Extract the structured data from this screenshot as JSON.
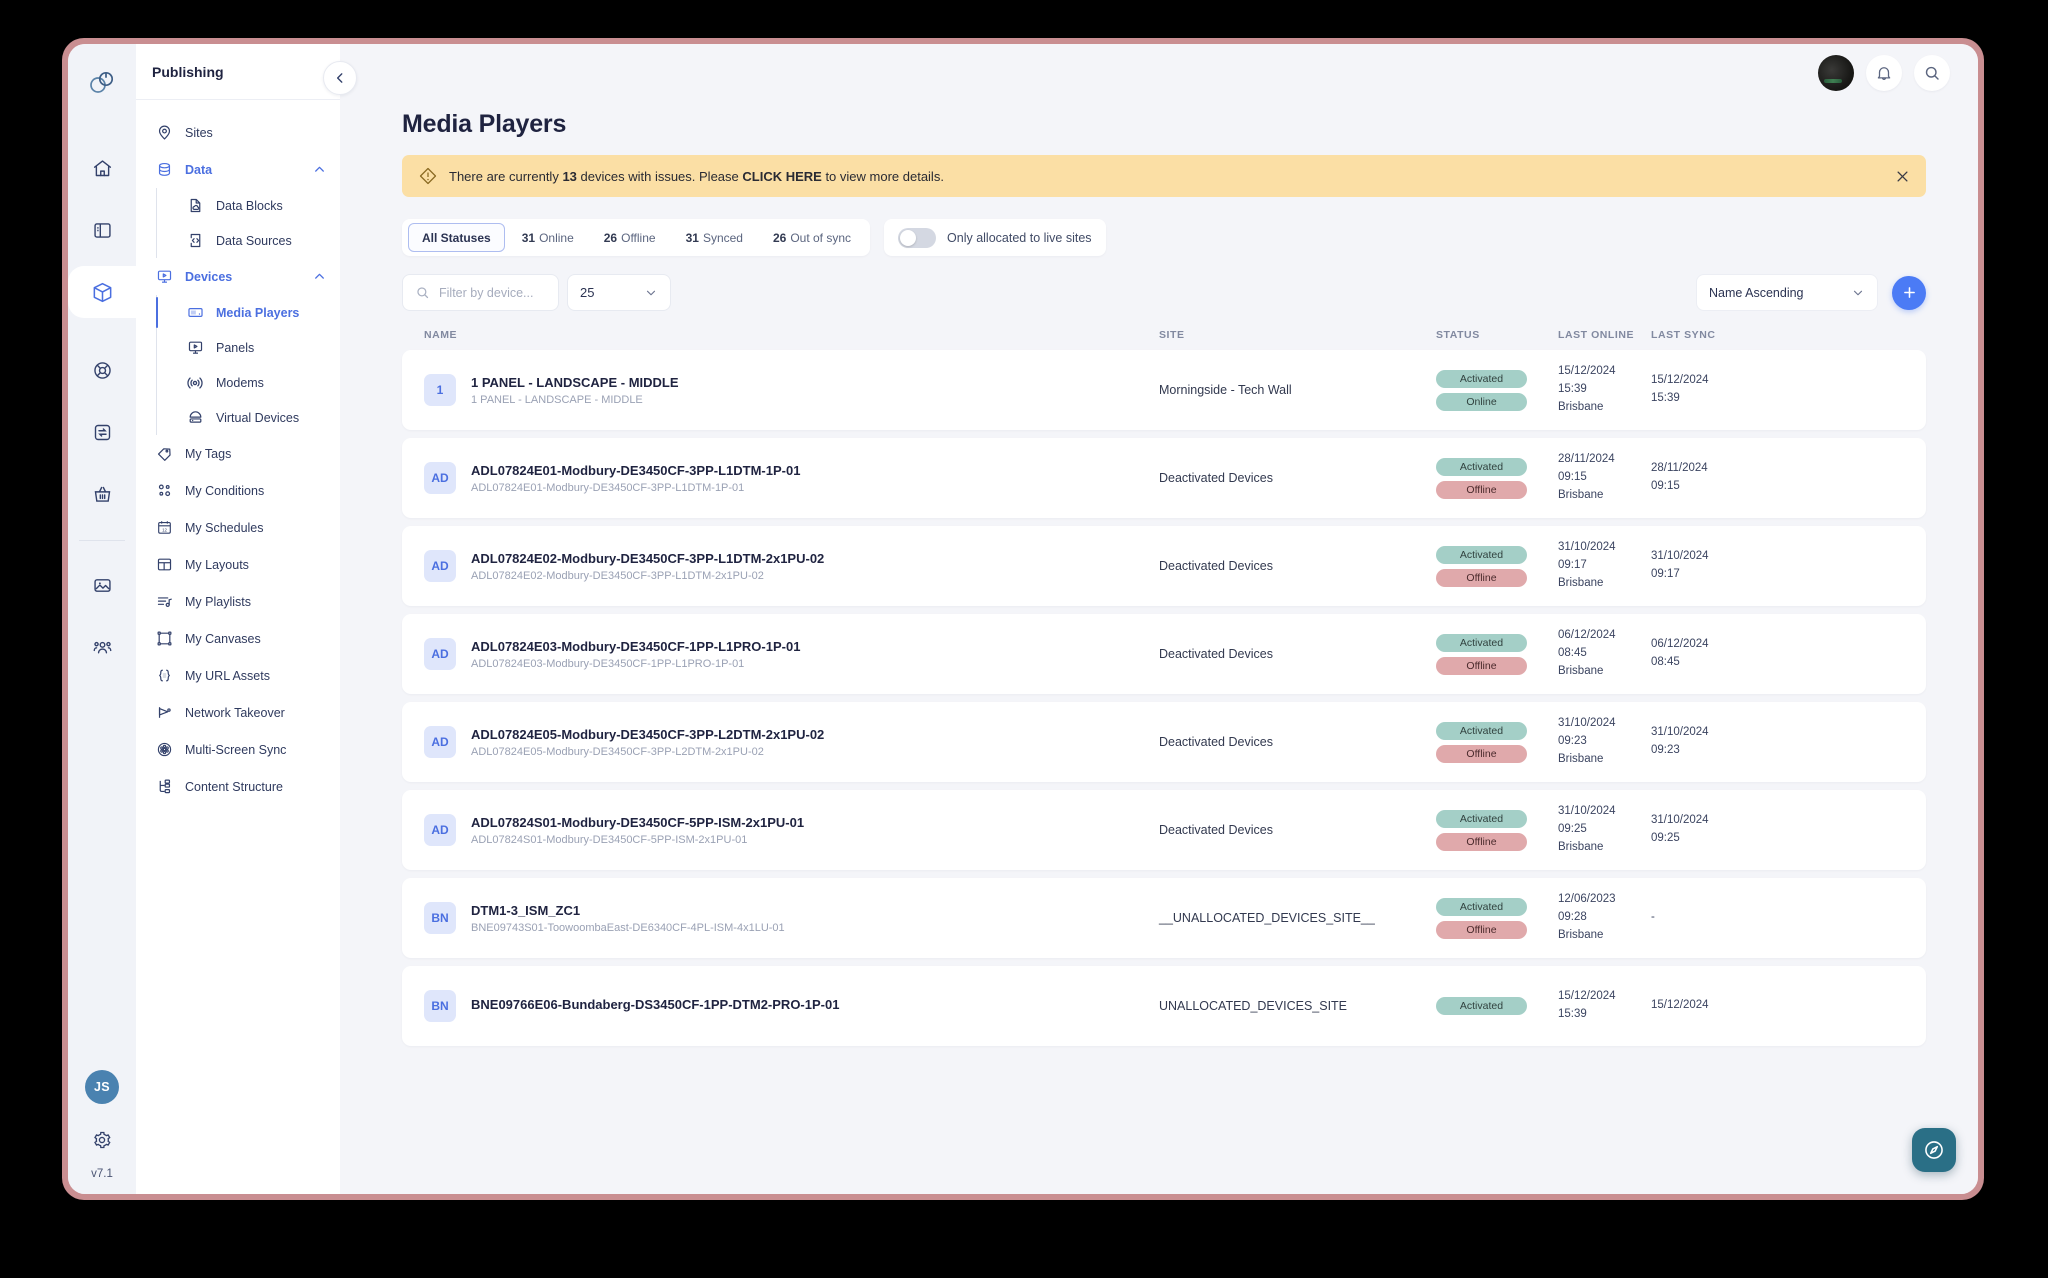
{
  "rail": {
    "logo_icon": "brand-logo-icon",
    "items": [
      {
        "name": "home",
        "icon": "home-icon"
      },
      {
        "name": "layout",
        "icon": "sidebar-layout-icon"
      },
      {
        "name": "publishing",
        "icon": "package-box-icon",
        "active": true
      },
      {
        "name": "support",
        "icon": "lifebuoy-icon"
      },
      {
        "name": "exchange",
        "icon": "exchange-arrows-icon"
      },
      {
        "name": "basket",
        "icon": "basket-icon"
      },
      {
        "name": "media",
        "icon": "image-icon"
      },
      {
        "name": "audience",
        "icon": "people-group-icon"
      }
    ],
    "user_initials": "JS",
    "settings_icon": "gear-icon",
    "version": "v7.1"
  },
  "nav": {
    "title": "Publishing",
    "collapse_icon": "chevron-left-icon",
    "items": [
      {
        "label": "Sites",
        "icon": "map-pin-icon"
      },
      {
        "label": "Data",
        "icon": "database-icon",
        "expandable": true,
        "expanded": true,
        "children": [
          {
            "label": "Data Blocks",
            "icon": "data-block-icon"
          },
          {
            "label": "Data Sources",
            "icon": "data-source-icon"
          }
        ]
      },
      {
        "label": "Devices",
        "icon": "device-screen-icon",
        "expandable": true,
        "expanded": true,
        "children": [
          {
            "label": "Media Players",
            "icon": "media-player-icon",
            "selected": true
          },
          {
            "label": "Panels",
            "icon": "panel-icon"
          },
          {
            "label": "Modems",
            "icon": "modem-signal-icon"
          },
          {
            "label": "Virtual Devices",
            "icon": "virtual-device-icon"
          }
        ]
      },
      {
        "label": "My Tags",
        "icon": "tag-icon"
      },
      {
        "label": "My Conditions",
        "icon": "conditions-icon"
      },
      {
        "label": "My Schedules",
        "icon": "calendar-icon"
      },
      {
        "label": "My Layouts",
        "icon": "layout-grid-icon"
      },
      {
        "label": "My Playlists",
        "icon": "playlist-icon"
      },
      {
        "label": "My Canvases",
        "icon": "canvas-icon"
      },
      {
        "label": "My URL Assets",
        "icon": "braces-icon"
      },
      {
        "label": "Network Takeover",
        "icon": "megaphone-icon"
      },
      {
        "label": "Multi-Screen Sync",
        "icon": "film-reel-icon"
      },
      {
        "label": "Content Structure",
        "icon": "structure-tree-icon"
      }
    ]
  },
  "topbar": {
    "avatar": "user-avatar",
    "notifications_icon": "bell-icon",
    "search_icon": "search-icon"
  },
  "page": {
    "title": "Media Players"
  },
  "alert": {
    "icon": "warning-diamond-icon",
    "prefix": "There are currently ",
    "count": "13",
    "middle": " devices with issues. Please ",
    "link": "CLICK HERE",
    "suffix": " to view more details.",
    "close_icon": "close-icon"
  },
  "status_tabs": [
    {
      "count": "",
      "label": "All Statuses",
      "active": true
    },
    {
      "count": "31",
      "label": "Online"
    },
    {
      "count": "26",
      "label": "Offline"
    },
    {
      "count": "31",
      "label": "Synced"
    },
    {
      "count": "26",
      "label": "Out of sync"
    }
  ],
  "live_toggle": {
    "label": "Only allocated to live sites",
    "on": false
  },
  "search": {
    "placeholder": "Filter by device...",
    "value": "",
    "icon": "search-icon"
  },
  "page_size": {
    "value": "25",
    "icon": "chevron-down-icon"
  },
  "sort": {
    "value": "Name Ascending",
    "icon": "chevron-down-icon"
  },
  "add_button": {
    "label": "+",
    "name": "add-device-button"
  },
  "table": {
    "headers": {
      "name": "NAME",
      "site": "SITE",
      "status": "STATUS",
      "last_online": "LAST ONLINE",
      "last_sync": "LAST SYNC"
    },
    "rows": [
      {
        "badge": "1",
        "name": "1 PANEL - LANDSCAPE - MIDDLE",
        "sub": "1 PANEL - LANDSCAPE - MIDDLE",
        "site": "Morningside - Tech Wall",
        "status": [
          "Activated",
          "Online"
        ],
        "status_kind": [
          "activated",
          "online"
        ],
        "last_online_date": "15/12/2024",
        "last_online_time": "15:39",
        "last_online_tz": "Brisbane",
        "last_sync_date": "15/12/2024",
        "last_sync_time": "15:39"
      },
      {
        "badge": "AD",
        "name": "ADL07824E01-Modbury-DE3450CF-3PP-L1DTM-1P-01",
        "sub": "ADL07824E01-Modbury-DE3450CF-3PP-L1DTM-1P-01",
        "site": "Deactivated Devices",
        "status": [
          "Activated",
          "Offline"
        ],
        "status_kind": [
          "activated",
          "offline"
        ],
        "last_online_date": "28/11/2024",
        "last_online_time": "09:15",
        "last_online_tz": "Brisbane",
        "last_sync_date": "28/11/2024",
        "last_sync_time": "09:15"
      },
      {
        "badge": "AD",
        "name": "ADL07824E02-Modbury-DE3450CF-3PP-L1DTM-2x1PU-02",
        "sub": "ADL07824E02-Modbury-DE3450CF-3PP-L1DTM-2x1PU-02",
        "site": "Deactivated Devices",
        "status": [
          "Activated",
          "Offline"
        ],
        "status_kind": [
          "activated",
          "offline"
        ],
        "last_online_date": "31/10/2024",
        "last_online_time": "09:17",
        "last_online_tz": "Brisbane",
        "last_sync_date": "31/10/2024",
        "last_sync_time": "09:17"
      },
      {
        "badge": "AD",
        "name": "ADL07824E03-Modbury-DE3450CF-1PP-L1PRO-1P-01",
        "sub": "ADL07824E03-Modbury-DE3450CF-1PP-L1PRO-1P-01",
        "site": "Deactivated Devices",
        "status": [
          "Activated",
          "Offline"
        ],
        "status_kind": [
          "activated",
          "offline"
        ],
        "last_online_date": "06/12/2024",
        "last_online_time": "08:45",
        "last_online_tz": "Brisbane",
        "last_sync_date": "06/12/2024",
        "last_sync_time": "08:45"
      },
      {
        "badge": "AD",
        "name": "ADL07824E05-Modbury-DE3450CF-3PP-L2DTM-2x1PU-02",
        "sub": "ADL07824E05-Modbury-DE3450CF-3PP-L2DTM-2x1PU-02",
        "site": "Deactivated Devices",
        "status": [
          "Activated",
          "Offline"
        ],
        "status_kind": [
          "activated",
          "offline"
        ],
        "last_online_date": "31/10/2024",
        "last_online_time": "09:23",
        "last_online_tz": "Brisbane",
        "last_sync_date": "31/10/2024",
        "last_sync_time": "09:23"
      },
      {
        "badge": "AD",
        "name": "ADL07824S01-Modbury-DE3450CF-5PP-ISM-2x1PU-01",
        "sub": "ADL07824S01-Modbury-DE3450CF-5PP-ISM-2x1PU-01",
        "site": "Deactivated Devices",
        "status": [
          "Activated",
          "Offline"
        ],
        "status_kind": [
          "activated",
          "offline"
        ],
        "last_online_date": "31/10/2024",
        "last_online_time": "09:25",
        "last_online_tz": "Brisbane",
        "last_sync_date": "31/10/2024",
        "last_sync_time": "09:25"
      },
      {
        "badge": "BN",
        "name": "DTM1-3_ISM_ZC1",
        "sub": "BNE09743S01-ToowoombaEast-DE6340CF-4PL-ISM-4x1LU-01",
        "site": "__UNALLOCATED_DEVICES_SITE__",
        "status": [
          "Activated",
          "Offline"
        ],
        "status_kind": [
          "activated",
          "offline"
        ],
        "last_online_date": "12/06/2023",
        "last_online_time": "09:28",
        "last_online_tz": "Brisbane",
        "last_sync_date": "-",
        "last_sync_time": ""
      },
      {
        "badge": "BN",
        "name": "BNE09766E06-Bundaberg-DS3450CF-1PP-DTM2-PRO-1P-01",
        "sub": "",
        "site": "UNALLOCATED_DEVICES_SITE",
        "status": [
          "Activated",
          ""
        ],
        "status_kind": [
          "activated",
          ""
        ],
        "last_online_date": "15/12/2024",
        "last_online_time": "15:39",
        "last_online_tz": "",
        "last_sync_date": "15/12/2024",
        "last_sync_time": ""
      }
    ]
  },
  "help_fab": {
    "icon": "help-compass-icon"
  }
}
